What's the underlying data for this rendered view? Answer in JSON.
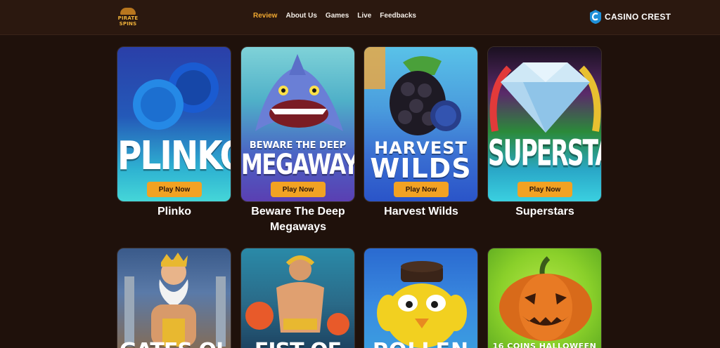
{
  "header": {
    "logo_line1": "PIRATE",
    "logo_line2": "SPINS",
    "nav": [
      "Review",
      "About Us",
      "Games",
      "Live",
      "Feedbacks"
    ],
    "active_nav": "Review",
    "brand_name": "CASINO CREST"
  },
  "games_row1": [
    {
      "art_title": "PLINKO",
      "button": "Play Now",
      "name": "Plinko"
    },
    {
      "art_title_top": "BEWARE THE DEEP",
      "art_title": "MEGAWAYS",
      "button": "Play Now",
      "name_line1": "Beware The Deep",
      "name_line2": "Megaways"
    },
    {
      "art_title_top": "HARVEST",
      "art_title": "WILDS",
      "button": "Play Now",
      "name": "Harvest Wilds"
    },
    {
      "art_title": "SUPERSTARS",
      "button": "Play Now",
      "name": "Superstars"
    }
  ],
  "games_row2": [
    {
      "art_title": "GATES OL"
    },
    {
      "art_title": "FIST OF"
    },
    {
      "art_title": "POLLEN"
    },
    {
      "art_title": "16 COINS HALLOWEEN"
    }
  ],
  "colors": {
    "background": "#1f110b",
    "header": "#2b180f",
    "accent": "#f0a830",
    "button": "#f2a223"
  }
}
